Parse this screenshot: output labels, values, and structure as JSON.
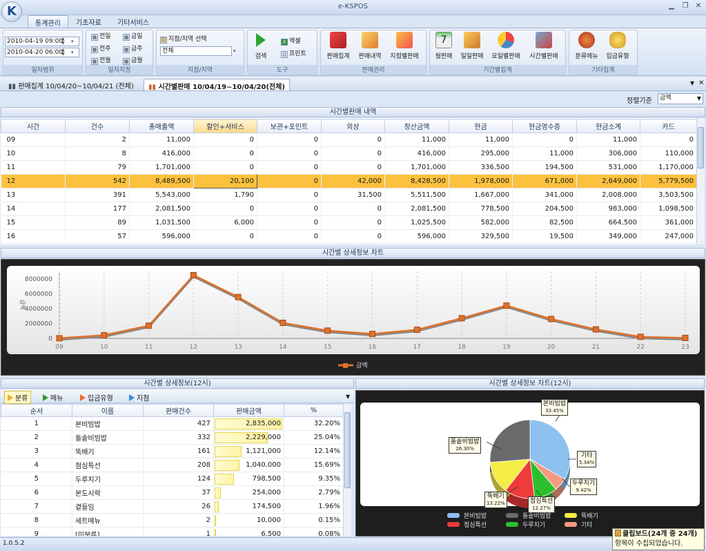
{
  "window": {
    "title": "e-KSPOS",
    "logo_text": "K"
  },
  "menu_tabs": [
    "통계관리",
    "기초자료",
    "기타서비스"
  ],
  "ribbon": {
    "date_range": {
      "from": "2010-04-19 09:00",
      "to": "2010-04-20 06:00",
      "group_label": "일자범위"
    },
    "date_presets": {
      "buttons": [
        "전일",
        "금일",
        "전주",
        "금주",
        "전월",
        "금월"
      ],
      "group_label": "일자지정"
    },
    "branch": {
      "title": "지점/지역 선택",
      "value": "전체",
      "group_label": "지점/지역"
    },
    "tools": {
      "search": "검색",
      "excel": "엑셀",
      "print": "프린트",
      "group_label": "도구"
    },
    "sales_mgmt": {
      "buttons": [
        "판매집계",
        "판매내역",
        "지점별판매"
      ],
      "group_label": "판매관리"
    },
    "period": {
      "buttons": [
        "월판매",
        "일일판매",
        "요일별판매",
        "시간별판매"
      ],
      "group_label": "기간별집계"
    },
    "other": {
      "buttons": [
        "분류메뉴",
        "입금유형"
      ],
      "group_label": "기타집계"
    }
  },
  "doc_tabs": [
    "판매집계 10/04/20~10/04/21 (전체)",
    "시간별판매 10/04/19~10/04/20(전체)"
  ],
  "sort": {
    "label": "정렬기준",
    "value": "금액"
  },
  "main_table": {
    "title": "시간별판매 내역",
    "columns": [
      "시간",
      "건수",
      "총매출액",
      "할인+서비스",
      "보관+포인트",
      "외상",
      "정산금액",
      "현금",
      "현금영수증",
      "현금소계",
      "카드"
    ],
    "rows": [
      [
        "09",
        "2",
        "11,000",
        "0",
        "0",
        "0",
        "11,000",
        "11,000",
        "0",
        "11,000",
        "0"
      ],
      [
        "10",
        "8",
        "416,000",
        "0",
        "0",
        "0",
        "416,000",
        "295,000",
        "11,000",
        "306,000",
        "110,000"
      ],
      [
        "11",
        "79",
        "1,701,000",
        "0",
        "0",
        "0",
        "1,701,000",
        "336,500",
        "194,500",
        "531,000",
        "1,170,000"
      ],
      [
        "12",
        "542",
        "8,489,500",
        "20,100",
        "0",
        "42,000",
        "8,428,500",
        "1,978,000",
        "671,000",
        "2,649,000",
        "5,779,500"
      ],
      [
        "13",
        "391",
        "5,543,000",
        "1,790",
        "0",
        "31,500",
        "5,511,500",
        "1,667,000",
        "341,000",
        "2,008,000",
        "3,503,500"
      ],
      [
        "14",
        "177",
        "2,081,500",
        "0",
        "0",
        "0",
        "2,081,500",
        "778,500",
        "204,500",
        "983,000",
        "1,098,500"
      ],
      [
        "15",
        "89",
        "1,031,500",
        "6,000",
        "0",
        "0",
        "1,025,500",
        "582,000",
        "82,500",
        "664,500",
        "361,000"
      ],
      [
        "16",
        "57",
        "596,000",
        "0",
        "0",
        "0",
        "596,000",
        "329,500",
        "19,500",
        "349,000",
        "247,000"
      ]
    ],
    "selected_row": 3
  },
  "chart_data": [
    {
      "type": "line",
      "title": "시간별 상세정보 차트",
      "ylabel": "금액",
      "x": [
        "09",
        "10",
        "11",
        "12",
        "13",
        "14",
        "15",
        "16",
        "17",
        "18",
        "19",
        "20",
        "21",
        "22",
        "23"
      ],
      "series": [
        {
          "name": "금액",
          "values": [
            11000,
            416000,
            1701000,
            8489500,
            5543000,
            2081500,
            1031500,
            596000,
            1150000,
            2700000,
            4400000,
            2600000,
            1200000,
            200000,
            50000
          ]
        }
      ],
      "yticks": [
        "0",
        "2000000",
        "4000000",
        "6000000",
        "8000000"
      ],
      "ylim": [
        0,
        9000000
      ],
      "color": "#e0702a"
    },
    {
      "type": "pie",
      "title": "시간별 상세정보 차트(12시)",
      "categories": [
        "본비빔밥",
        "돌솥비빔밥",
        "뚝배기",
        "점심특선",
        "두루치기",
        "기타"
      ],
      "values": [
        33.45,
        26.3,
        13.22,
        12.27,
        9.42,
        5.34
      ],
      "labels": [
        "33.45%",
        "26.30%",
        "13.22%",
        "12.27%",
        "9.42%",
        "5.34%"
      ],
      "colors": [
        "#8ec0f0",
        "#6a6a6a",
        "#f5ec45",
        "#ee3b3b",
        "#2dbf2d",
        "#f59a7e"
      ]
    }
  ],
  "detail": {
    "title": "시간별 상세정보(12시)",
    "subtabs": [
      "분류",
      "메뉴",
      "입금유형",
      "지점"
    ],
    "columns": [
      "순서",
      "이름",
      "판매건수",
      "판매금액",
      "%"
    ],
    "rows": [
      [
        "1",
        "본비빔밥",
        "427",
        "2,835,000",
        "32.20%"
      ],
      [
        "2",
        "돌솥비빔밥",
        "332",
        "2,229,000",
        "25.04%"
      ],
      [
        "3",
        "뚝배기",
        "161",
        "1,121,000",
        "12.14%"
      ],
      [
        "4",
        "점심특선",
        "208",
        "1,040,000",
        "15.69%"
      ],
      [
        "5",
        "두루치기",
        "124",
        "798,500",
        "9.35%"
      ],
      [
        "6",
        "본도시락",
        "37",
        "254,000",
        "2.79%"
      ],
      [
        "7",
        "곁들임",
        "26",
        "174,500",
        "1.96%"
      ],
      [
        "8",
        "세트메뉴",
        "2",
        "10,000",
        "0.15%"
      ],
      [
        "9",
        "[미분류]",
        "1",
        "6,500",
        "0.08%"
      ]
    ],
    "bar_fraction": [
      1.0,
      0.786,
      0.395,
      0.367,
      0.282,
      0.09,
      0.062,
      0.004,
      0.002
    ]
  },
  "status": {
    "version": "1.0.5.2"
  },
  "clipboard": {
    "title": "클립보드(24개 중 24개)",
    "message": "항목이 수집되었습니다."
  }
}
